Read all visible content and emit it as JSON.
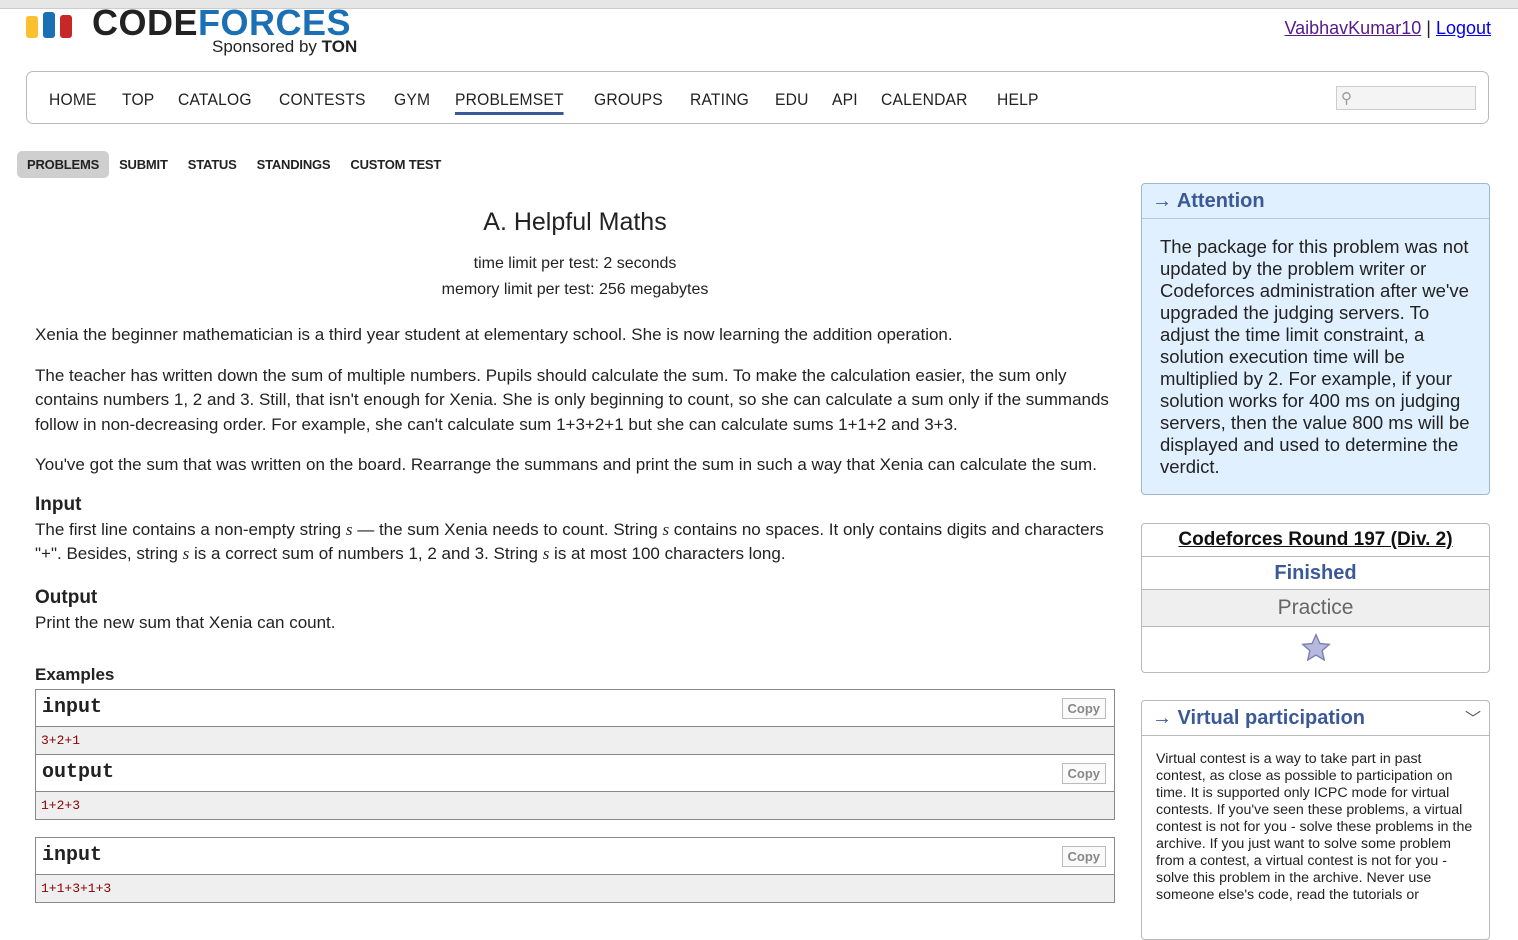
{
  "brand": {
    "logo_main": "CODE",
    "logo_accent": "FORCES",
    "sponsor_prefix": "Sponsored by",
    "sponsor_name": "TON",
    "colors": {
      "bar1": "#fbc02d",
      "bar2": "#1a6fb5",
      "bar3": "#c62828"
    }
  },
  "user": {
    "username": "VaibhavKumar10",
    "separator": "|",
    "logout": "Logout"
  },
  "main_menu": {
    "items": [
      "HOME",
      "TOP",
      "CATALOG",
      "CONTESTS",
      "GYM",
      "PROBLEMSET",
      "GROUPS",
      "RATING",
      "EDU",
      "API",
      "CALENDAR",
      "HELP"
    ],
    "active": "PROBLEMSET",
    "search_icon": "magnifier-icon"
  },
  "sub_menu": {
    "items": [
      "PROBLEMS",
      "SUBMIT",
      "STATUS",
      "STANDINGS",
      "CUSTOM TEST"
    ],
    "active": "PROBLEMS"
  },
  "problem": {
    "title": "A. Helpful Maths",
    "time_limit": "time limit per test: 2 seconds",
    "memory_limit": "memory limit per test: 256 megabytes",
    "statement": [
      "Xenia the beginner mathematician is a third year student at elementary school. She is now learning the addition operation.",
      "The teacher has written down the sum of multiple numbers. Pupils should calculate the sum. To make the calculation easier, the sum only contains numbers 1, 2 and 3. Still, that isn't enough for Xenia. She is only beginning to count, so she can calculate a sum only if the summands follow in non-decreasing order. For example, she can't calculate sum 1+3+2+1 but she can calculate sums 1+1+2 and 3+3.",
      "You've got the sum that was written on the board. Rearrange the summans and print the sum in such a way that Xenia can calculate the sum."
    ],
    "input_title": "Input",
    "input_parts": {
      "p1": "The first line contains a non-empty string ",
      "var": "s",
      "p2": " — the sum Xenia needs to count. String ",
      "p3": " contains no spaces. It only contains digits and characters \"+\". Besides, string ",
      "p4": " is a correct sum of numbers 1, 2 and 3. String ",
      "p5": " is at most 100 characters long."
    },
    "output_title": "Output",
    "output_text": "Print the new sum that Xenia can count.",
    "examples_title": "Examples",
    "copy_label": "Copy",
    "examples": [
      {
        "input_label": "input",
        "input": "3+2+1",
        "output_label": "output",
        "output": "1+2+3"
      },
      {
        "input_label": "input",
        "input": "1+1+3+1+3"
      }
    ]
  },
  "attention": {
    "title": "→ Attention",
    "text": "The package for this problem was not updated by the problem writer or Codeforces administration after we've upgraded the judging servers. To adjust the time limit constraint, a solution execution time will be multiplied by 2. For example, if your solution works for 400 ms on judging servers, then the value 800 ms will be displayed and used to determine the verdict."
  },
  "round": {
    "name": "Codeforces Round 197 (Div. 2)",
    "status": "Finished",
    "mode": "Practice",
    "favorite_icon": "star-icon"
  },
  "virtual": {
    "title": "→ Virtual participation",
    "text": "Virtual contest is a way to take part in past contest, as close as possible to participation on time. It is supported only ICPC mode for virtual contests. If you've seen these problems, a virtual contest is not for you - solve these problems in the archive. If you just want to solve some problem from a contest, a virtual contest is not for you - solve this problem in the archive. Never use someone else's code, read the tutorials or"
  }
}
